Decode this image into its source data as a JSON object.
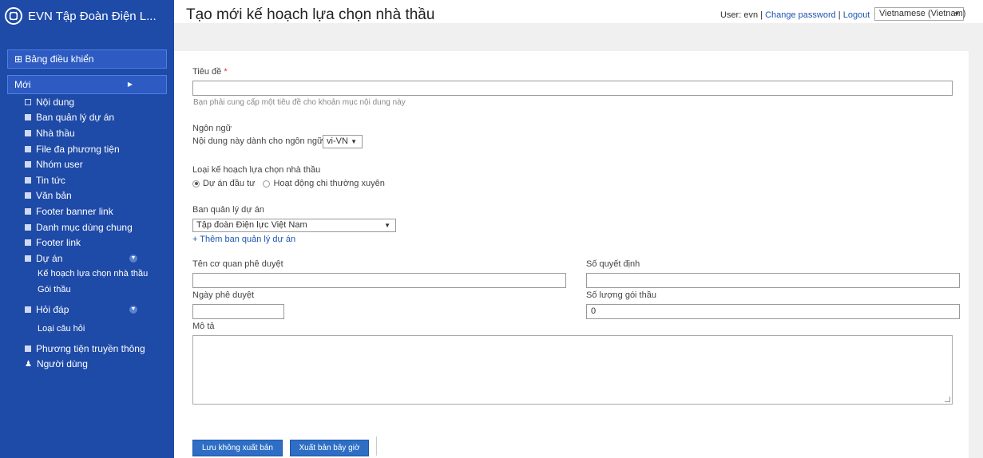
{
  "brand": {
    "name": "EVN Tập Đoàn Điện L...",
    "logo_icon": "evn-logo-icon"
  },
  "header": {
    "title": "Tạo mới kế hoạch lựa chọn nhà thầu",
    "user_prefix": "User: evn",
    "sep": "|",
    "change_password": "Change password",
    "logout": "Logout",
    "language": "Vietnamese (Vietnam)"
  },
  "sidebar": {
    "dashboard": "⊞ Bảng điều khiển",
    "new": "Mới",
    "items": [
      {
        "label": "Nội dung"
      },
      {
        "label": "Ban quản lý dự án"
      },
      {
        "label": "Nhà thầu"
      },
      {
        "label": "File đa phương tiện"
      },
      {
        "label": "Nhóm user"
      },
      {
        "label": "Tin tức"
      },
      {
        "label": "Văn bản"
      },
      {
        "label": "Footer banner link"
      },
      {
        "label": "Danh mục dùng chung"
      },
      {
        "label": "Footer link"
      },
      {
        "label": "Dự án"
      },
      {
        "label": "Kế hoạch lựa chọn nhà thầu"
      },
      {
        "label": "Gói thầu"
      },
      {
        "label": "Hỏi đáp"
      },
      {
        "label": "Loại câu hỏi"
      },
      {
        "label": "Phương tiện truyền thông"
      },
      {
        "label": "Người dùng"
      }
    ]
  },
  "form": {
    "title_label": "Tiêu đề",
    "required_mark": "*",
    "title_value": "",
    "title_hint": "Bạn phải cung cấp một tiêu đề cho khoản mục nội dung này",
    "language_label": "Ngôn ngữ",
    "language_desc": "Nội dung này dành cho ngôn ngữ",
    "language_value": "vi-VN",
    "plan_type_label": "Loại kế hoạch lựa chọn nhà thầu",
    "plan_type_options": [
      "Dự án đầu tư",
      "Hoạt động chi thường xuyên"
    ],
    "plan_type_selected": "Dự án đầu tư",
    "board_label": "Ban quản lý dự án",
    "board_value": "Tập đoàn Điện lực Việt Nam",
    "add_board": "+ Thêm ban quản lý dự án",
    "approver_label": "Tên cơ quan phê duyệt",
    "approver_value": "",
    "decision_label": "Số quyết định",
    "decision_value": "",
    "approve_date_label": "Ngày phê duyệt",
    "approve_date_value": "",
    "package_count_label": "Số lượng gói thầu",
    "package_count_value": "0",
    "description_label": "Mô tả",
    "description_value": ""
  },
  "actions": {
    "save_unpublished": "Lưu không xuất bản",
    "publish_now": "Xuất bản bây giờ"
  },
  "colors": {
    "sidebar_bg": "#1e4aa8",
    "button_bg": "#2e6fc5",
    "link": "#1e56b0"
  }
}
